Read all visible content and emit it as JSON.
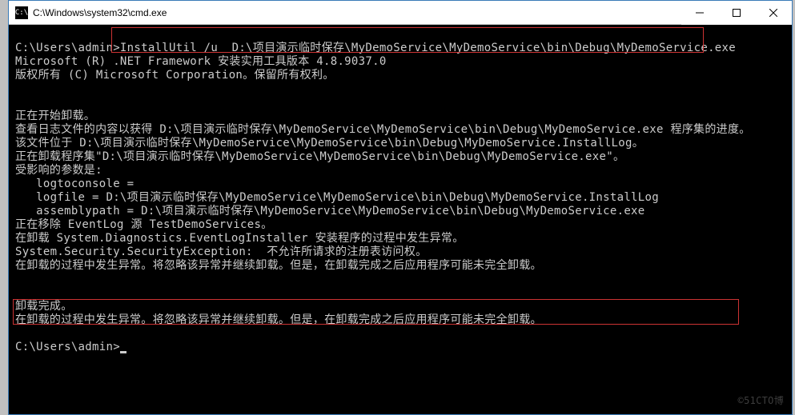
{
  "window": {
    "title": "C:\\Windows\\system32\\cmd.exe",
    "icon_label": "C:\\"
  },
  "terminal": {
    "lines": [
      "",
      "C:\\Users\\admin>InstallUtil /u  D:\\项目演示临时保存\\MyDemoService\\MyDemoService\\bin\\Debug\\MyDemoService.exe",
      "Microsoft (R) .NET Framework 安装实用工具版本 4.8.9037.0",
      "版权所有 (C) Microsoft Corporation。保留所有权利。",
      "",
      "",
      "正在开始卸载。",
      "查看日志文件的内容以获得 D:\\项目演示临时保存\\MyDemoService\\MyDemoService\\bin\\Debug\\MyDemoService.exe 程序集的进度。",
      "该文件位于 D:\\项目演示临时保存\\MyDemoService\\MyDemoService\\bin\\Debug\\MyDemoService.InstallLog。",
      "正在卸载程序集\"D:\\项目演示临时保存\\MyDemoService\\MyDemoService\\bin\\Debug\\MyDemoService.exe\"。",
      "受影响的参数是:",
      "   logtoconsole =",
      "   logfile = D:\\项目演示临时保存\\MyDemoService\\MyDemoService\\bin\\Debug\\MyDemoService.InstallLog",
      "   assemblypath = D:\\项目演示临时保存\\MyDemoService\\MyDemoService\\bin\\Debug\\MyDemoService.exe",
      "正在移除 EventLog 源 TestDemoServices。",
      "在卸载 System.Diagnostics.EventLogInstaller 安装程序的过程中发生异常。",
      "System.Security.SecurityException:  不允许所请求的注册表访问权。",
      "在卸载的过程中发生异常。将忽略该异常并继续卸载。但是，在卸载完成之后应用程序可能未完全卸载。",
      "",
      "",
      "卸载完成。",
      "在卸载的过程中发生异常。将忽略该异常并继续卸载。但是，在卸载完成之后应用程序可能未完全卸载。",
      "",
      "C:\\Users\\admin>"
    ]
  },
  "watermark": "©51CTO博"
}
